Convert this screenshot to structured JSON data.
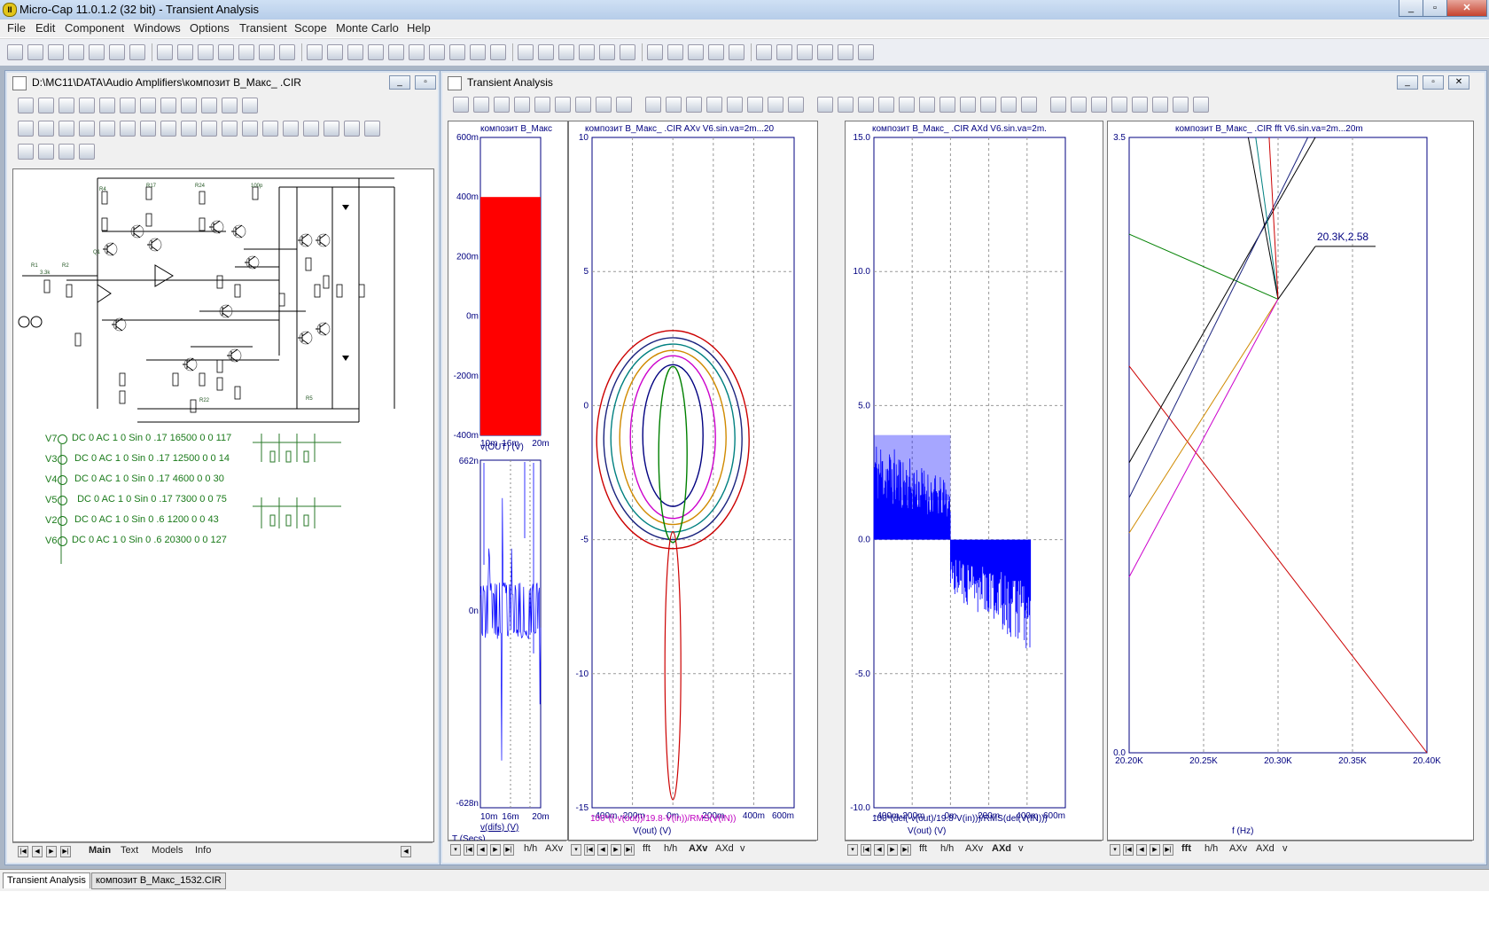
{
  "app": {
    "title": "Micro-Cap 11.0.1.2 (32 bit) - Transient Analysis",
    "icon": "micro-cap-app-icon",
    "window_buttons": [
      "_",
      "▫",
      "✕"
    ]
  },
  "menu": [
    "File",
    "Edit",
    "Component",
    "Windows",
    "Options",
    "Transient",
    "Scope",
    "Monte Carlo",
    "Help"
  ],
  "schematic_window": {
    "title": "D:\\MC11\\DATA\\Audio Amplifiers\\композит В_Макс_      .CIR",
    "tabs": [
      "Main",
      "Text",
      "Models",
      "Info"
    ],
    "active_tab": "Main",
    "sources": [
      {
        "name": "V7",
        "spec": "DC 0 AC 1 0 Sin 0 .17 16500 0 0 117"
      },
      {
        "name": "V3",
        "spec": " DC 0 AC 1 0 Sin 0 .17 12500 0 0 14"
      },
      {
        "name": "V4",
        "spec": " DC 0 AC 1 0 Sin 0 .17 4600 0 0 30"
      },
      {
        "name": "V5",
        "spec": "  DC 0 AC 1 0 Sin 0 .17 7300 0 0 75"
      },
      {
        "name": "V2",
        "spec": " DC 0 AC 1 0 Sin 0 .6 1200 0 0 43"
      },
      {
        "name": "V6",
        "spec": "DC 0 AC 1 0 Sin 0 .6 20300 0 0 127"
      }
    ]
  },
  "analysis_window": {
    "title": "Transient Analysis",
    "panel1": {
      "title": "композит В_Макс",
      "top_plot": {
        "y_ticks": [
          "600m",
          "400m",
          "200m",
          "0m",
          "-200m",
          "-400m"
        ],
        "x_ticks": [
          "10m",
          "16m",
          "20m"
        ],
        "ylabel": "v(OUT) (V)"
      },
      "bottom_plot": {
        "y_ticks": [
          "662n",
          "0n",
          "-628n"
        ],
        "x_ticks": [
          "10m",
          "16m",
          "20m"
        ],
        "xlabel": "v(difs) (V)",
        "axis_label": "T (Secs)"
      },
      "tabs": [
        "h/h",
        "AXv"
      ]
    },
    "panel2": {
      "title": "композит В_Макс_          .CIR AXv V6.sin.va=2m...20",
      "y_ticks": [
        "10",
        "5",
        "0",
        "-5",
        "-10",
        "-15"
      ],
      "x_ticks": [
        "-400m",
        "-200m",
        "0m",
        "200m",
        "400m",
        "600m"
      ],
      "ylabel": "100*((-v(out))/19.8-V(in))/RMS(V(IN))",
      "xlabel": "V(out) (V)",
      "tabs": [
        "fft",
        "h/h",
        "AXv",
        "AXd",
        "v"
      ],
      "active_tab": "AXv"
    },
    "panel3": {
      "title": "композит В_Макс_          .CIR AXd V6.sin.va=2m.",
      "y_ticks": [
        "15.0",
        "10.0",
        "5.0",
        "0.0",
        "-5.0",
        "-10.0"
      ],
      "x_ticks": [
        "-400m",
        "-200m",
        "0m",
        "200m",
        "400m",
        "600m"
      ],
      "ylabel": "100*(del(-v(out)/19.8-V(in)))/RMS(del(V(IN)))",
      "xlabel": "V(out) (V)",
      "tabs": [
        "fft",
        "h/h",
        "AXv",
        "AXd",
        "v"
      ],
      "active_tab": "AXd"
    },
    "panel4": {
      "title": "композит В_Макс_          .CIR fft V6.sin.va=2m...20m",
      "y_ticks": [
        "3.5",
        "0.0"
      ],
      "x_ticks": [
        "20.20K",
        "20.25K",
        "20.30K",
        "20.35K",
        "20.40K"
      ],
      "xlabel": "f (Hz)",
      "annotation": "20.3K,2.58",
      "tabs": [
        "fft",
        "h/h",
        "AXv",
        "AXd",
        "v"
      ],
      "active_tab": "fft"
    }
  },
  "status_tabs": [
    "Transient Analysis",
    "композит В_Макс_1532.CIR"
  ],
  "chart_data": [
    {
      "type": "area",
      "title": "композит В_Макс",
      "ylabel": "v(OUT) (V)",
      "x": [
        10,
        20
      ],
      "values": [
        0.4,
        0.4
      ],
      "ylim": [
        -0.4,
        0.6
      ],
      "color": "#ff0000"
    },
    {
      "type": "line",
      "xlabel": "v(difs) (V)",
      "ylim": [
        -6.28e-07,
        6.62e-07
      ],
      "color": "#0000ff"
    },
    {
      "type": "line",
      "title": "композит В_Макс_          .CIR AXv V6.sin.va=2m...20",
      "xlabel": "V(out) (V)",
      "ylabel": "100*((-v(out))/19.8-V(in))/RMS(V(IN))",
      "xlim": [
        -0.4,
        0.6
      ],
      "ylim": [
        -15,
        10
      ],
      "series_colors": [
        "#cc0000",
        "#1a237e",
        "#008080",
        "#d08a00",
        "#cc00cc",
        "#000080",
        "#008000",
        "#cc0000"
      ]
    },
    {
      "type": "line",
      "title": "композит В_Макс_          .CIR AXd V6.sin.va=2m.",
      "xlabel": "V(out) (V)",
      "ylabel": "100*(del(-v(out)/19.8-V(in)))/RMS(del(V(IN)))",
      "xlim": [
        -0.4,
        0.6
      ],
      "ylim": [
        -10,
        15
      ],
      "color": "#0000ff"
    },
    {
      "type": "line",
      "title": "композит В_Макс_          .CIR fft V6.sin.va=2m...20m",
      "xlabel": "f (Hz)",
      "xlim": [
        20200,
        20400
      ],
      "ylim": [
        0,
        3.5
      ],
      "peak": {
        "x": 20300,
        "y": 2.58,
        "label": "20.3K,2.58"
      },
      "series_colors": [
        "#cc0000",
        "#008000",
        "#000000",
        "#1a237e",
        "#d08a00",
        "#cc00cc",
        "#008080"
      ]
    }
  ]
}
